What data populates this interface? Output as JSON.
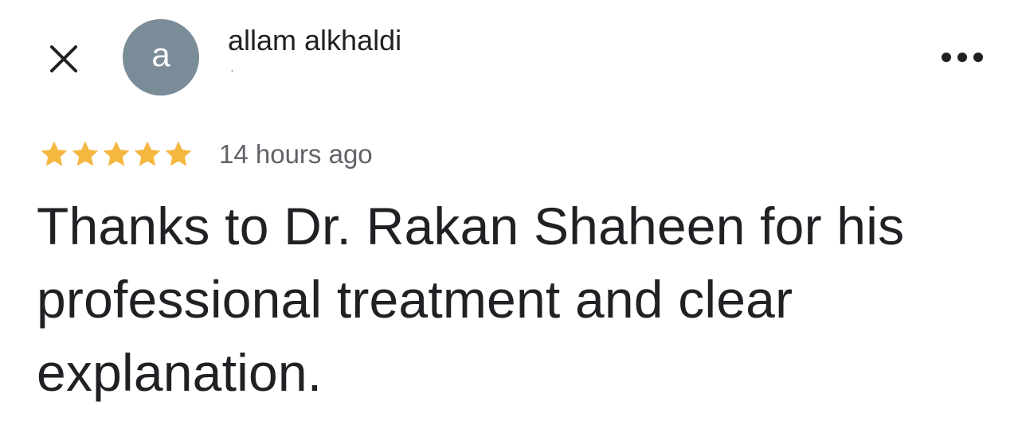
{
  "header": {
    "close_icon": "close-icon",
    "avatar_letter": "a",
    "avatar_color": "#7b8c99",
    "author_name": "allam alkhaldi",
    "author_sub": ".",
    "more_icon": "more-horizontal-icon"
  },
  "review": {
    "rating": 5,
    "rating_max": 5,
    "star_color": "#f4b740",
    "timestamp": "14 hours ago",
    "text": "Thanks to Dr. Rakan Shaheen for his professional treatment and clear explanation."
  }
}
